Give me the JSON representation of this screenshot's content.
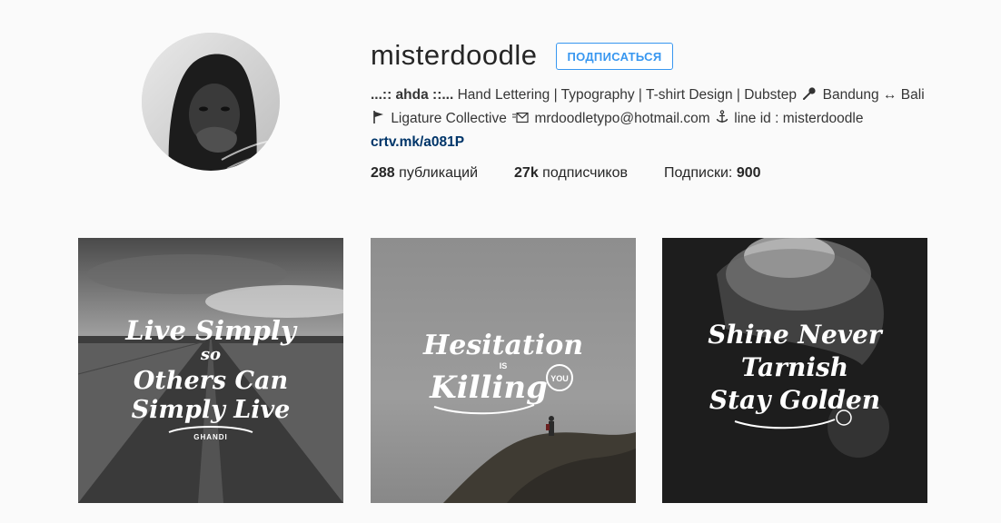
{
  "profile": {
    "username": "misterdoodle",
    "follow_label": "ПОДПИСАТЬСЯ",
    "bio": {
      "name": "...:: ahda ::...",
      "line1_rest": "Hand Lettering | Typography | T-shirt Design | Dubstep",
      "bandung": "Bandung",
      "arrow": "↔",
      "bali": "Bali",
      "ligature": "Ligature Collective",
      "email": "mrdoodletypo@hotmail.com",
      "line_id": "line id : misterdoodle"
    },
    "link": "crtv.mk/a081P",
    "stats": {
      "posts_count": "288",
      "posts_label": "публикаций",
      "followers_count": "27k",
      "followers_label": "подписчиков",
      "following_label": "Подписки:",
      "following_count": "900"
    }
  },
  "posts": [
    {
      "lines": [
        "Live Simply",
        "so",
        "Others Can",
        "Simply Live"
      ],
      "signature": "GHANDI",
      "scene": "road"
    },
    {
      "lines": [
        "Hesitation",
        "IS",
        "Killing",
        "YOU"
      ],
      "scene": "fog-cliff"
    },
    {
      "lines": [
        "Shine Never",
        "Tarnish",
        "Stay Golden"
      ],
      "scene": "portrait-dark"
    }
  ],
  "colors": {
    "accent_blue": "#3897f0",
    "link_blue": "#003569",
    "background": "#fafafa",
    "text": "#262626"
  },
  "icons": [
    "microphone-icon",
    "flag-icon",
    "envelope-icon",
    "anchor-icon"
  ]
}
